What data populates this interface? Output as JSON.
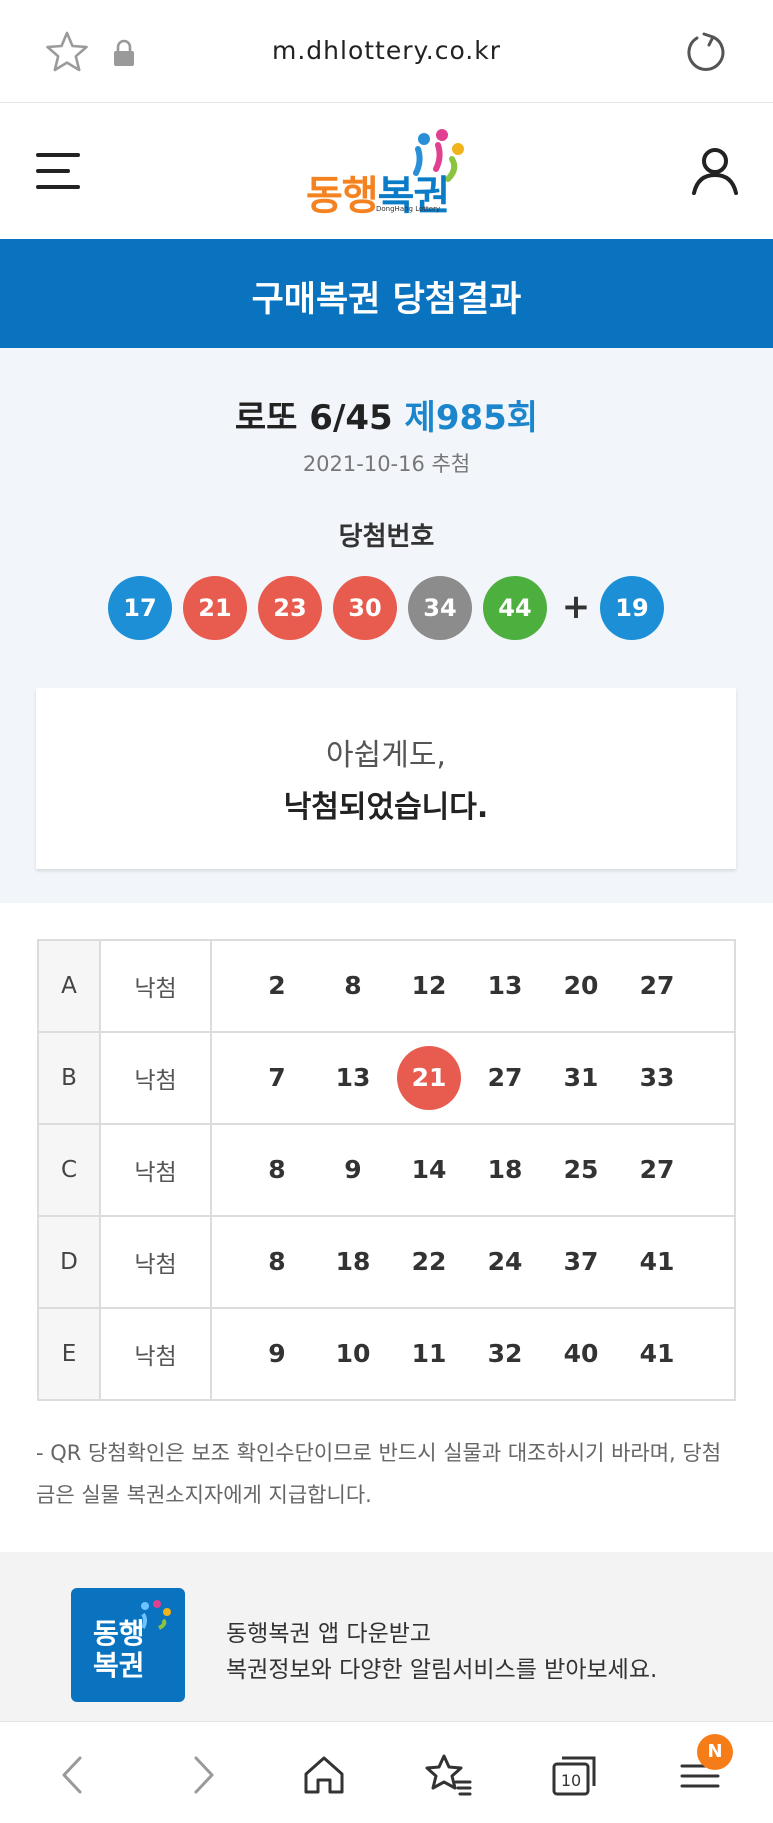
{
  "browser": {
    "url": "m.dhlottery.co.kr",
    "icons": [
      "star-icon",
      "lock-icon",
      "reload-icon"
    ]
  },
  "header": {
    "logo_text_part1": "동행",
    "logo_text_part2": "복권",
    "logo_sub": "DongHang Lottery",
    "icons": [
      "menu-icon",
      "user-icon"
    ]
  },
  "page_title": "구매복권 당첨결과",
  "result": {
    "game": "로또 6/45",
    "round": "제985회",
    "draw_date": "2021-10-16 추첨",
    "winning_label": "당첨번호",
    "winning_numbers": [
      {
        "n": "17",
        "color": "#1d8fd6"
      },
      {
        "n": "21",
        "color": "#e85c4f"
      },
      {
        "n": "23",
        "color": "#e85c4f"
      },
      {
        "n": "30",
        "color": "#e85c4f"
      },
      {
        "n": "34",
        "color": "#8c8c8c"
      },
      {
        "n": "44",
        "color": "#4caf3e"
      }
    ],
    "plus": "+",
    "bonus_number": {
      "n": "19",
      "color": "#1d8fd6"
    },
    "message_line1": "아쉽게도,",
    "message_line2": "낙첨되었습니다."
  },
  "tickets": [
    {
      "slot": "A",
      "status": "낙첨",
      "numbers": [
        "2",
        "8",
        "12",
        "13",
        "20",
        "27"
      ],
      "hits": []
    },
    {
      "slot": "B",
      "status": "낙첨",
      "numbers": [
        "7",
        "13",
        "21",
        "27",
        "31",
        "33"
      ],
      "hits": [
        2
      ]
    },
    {
      "slot": "C",
      "status": "낙첨",
      "numbers": [
        "8",
        "9",
        "14",
        "18",
        "25",
        "27"
      ],
      "hits": []
    },
    {
      "slot": "D",
      "status": "낙첨",
      "numbers": [
        "8",
        "18",
        "22",
        "24",
        "37",
        "41"
      ],
      "hits": []
    },
    {
      "slot": "E",
      "status": "낙첨",
      "numbers": [
        "9",
        "10",
        "11",
        "32",
        "40",
        "41"
      ],
      "hits": []
    }
  ],
  "notice": "- QR 당첨확인은 보조 확인수단이므로 반드시 실물과 대조하시기 바라며, 당첨금은 실물 복권소지자에게 지급합니다.",
  "promo": {
    "icon_line1": "동행",
    "icon_line2": "복권",
    "line1": "동행복권 앱 다운받고",
    "line2": "복권정보와 다양한 알림서비스를 받아보세요."
  },
  "bottom_nav": {
    "tabs_count": "10",
    "badge": "N",
    "icons": [
      "back-icon",
      "forward-icon",
      "home-icon",
      "bookmarks-icon",
      "tabs-icon",
      "menu-icon"
    ]
  },
  "colors": {
    "brand_blue": "#0a73bf",
    "brand_orange": "#f58220",
    "hit_red": "#e85c4f"
  }
}
